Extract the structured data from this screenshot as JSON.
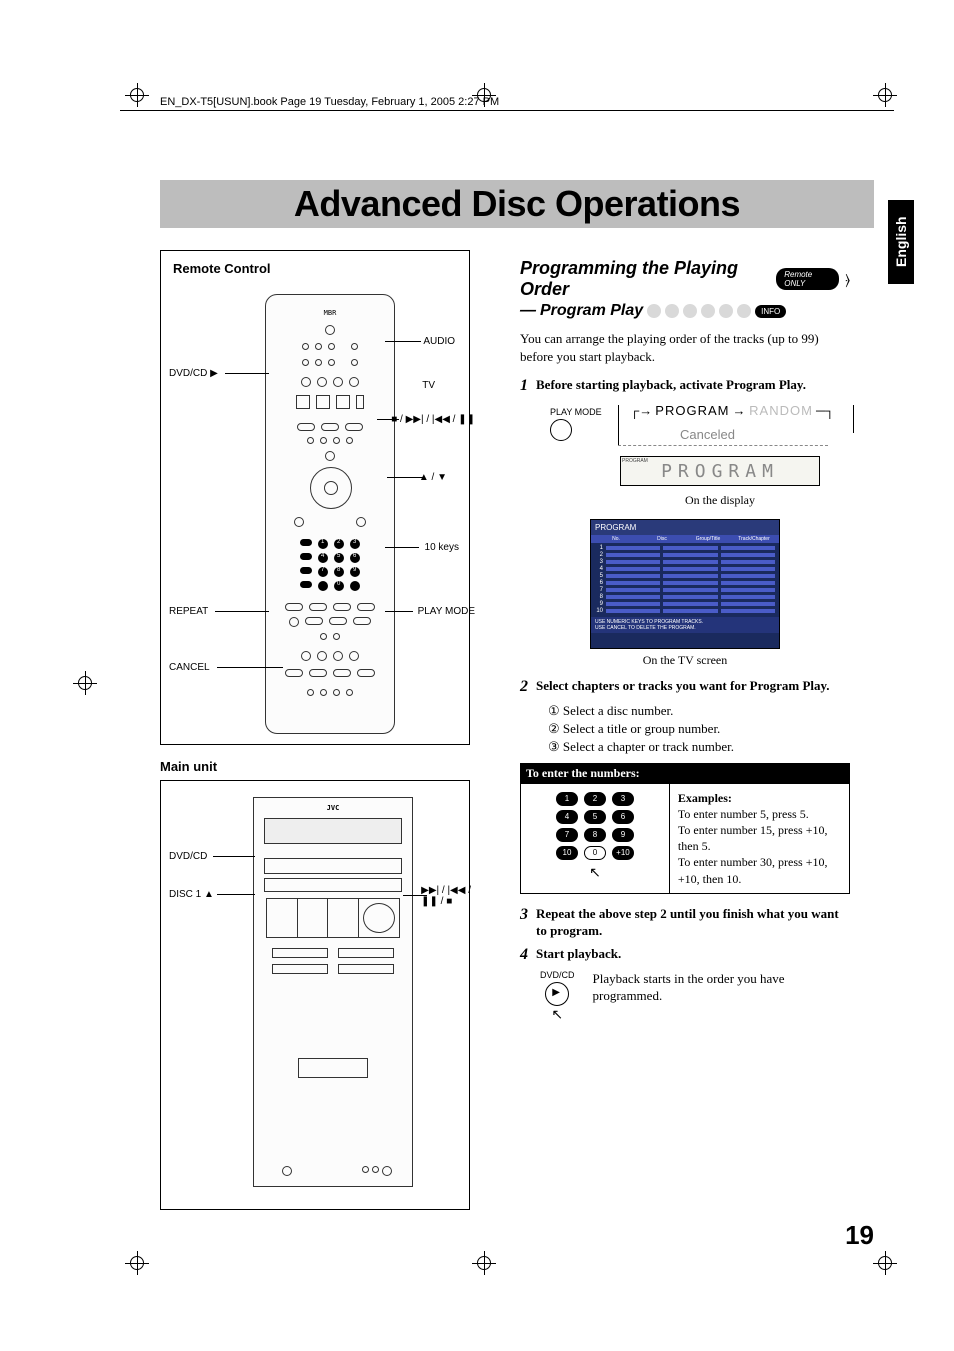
{
  "header": {
    "meta_line": "EN_DX-T5[USUN].book  Page 19  Tuesday, February 1, 2005  2:27 PM"
  },
  "lang_tab": "English",
  "title": "Advanced Disc Operations",
  "left": {
    "remote_title": "Remote Control",
    "main_unit_title": "Main unit",
    "labels": {
      "dvdcd_play": "DVD/CD ▶",
      "repeat": "REPEAT",
      "cancel": "CANCEL",
      "audio": "AUDIO",
      "tv": "TV",
      "ten_keys": "10 keys",
      "play_mode": "PLAY MODE",
      "stop_next": "■ / ▶▶| / |◀◀ / ❚❚",
      "up_down": "▲ / ▼",
      "dvdcd": "DVD/CD",
      "disc1": "DISC 1 ▲",
      "main_right": "▶▶| / |◀◀ /\n❚❚ / ■",
      "mbr": "MBR",
      "jvc": "JVC"
    }
  },
  "right": {
    "section_title": "Programming the Playing Order",
    "remote_only": "Remote ONLY",
    "subtitle_prefix": "—",
    "subtitle": "Program Play",
    "info": "INFO",
    "intro": "You can arrange the playing order of the tracks (up to 99) before you start playback.",
    "steps": {
      "s1": {
        "num": "1",
        "text": "Before starting playback, activate Program Play."
      },
      "s2": {
        "num": "2",
        "text": "Select chapters or tracks you want for Program Play."
      },
      "s3": {
        "num": "3",
        "text": "Repeat the above step 2 until you finish what you want to program."
      },
      "s4": {
        "num": "4",
        "text": "Start playback."
      }
    },
    "sub_items": {
      "a": "① Select a disc number.",
      "b": "② Select a title or group number.",
      "c": "③ Select a chapter or track number."
    },
    "diagram": {
      "play_mode": "PLAY MODE",
      "program": "PROGRAM",
      "random": "RANDOM",
      "canceled": "Canceled",
      "lcd": "PROGRAM",
      "caption1": "On the display",
      "caption2": "On the TV screen"
    },
    "tv": {
      "title": "PROGRAM",
      "hdr": {
        "no": "No.",
        "disc": "Disc",
        "group": "Group/Title",
        "track": "Track/Chapter"
      },
      "footer1": "USE NUMERIC KEYS TO PROGRAM TRACKS.",
      "footer2": "USE CANCEL TO DELETE THE PROGRAM."
    },
    "numbers": {
      "header": "To enter the numbers:",
      "keys": [
        "1",
        "2",
        "3",
        "4",
        "5",
        "6",
        "7",
        "8",
        "9",
        "10",
        "0",
        "+10"
      ],
      "examples_hdr": "Examples:",
      "ex1": "To enter number 5, press 5.",
      "ex2": "To enter number 15, press +10, then 5.",
      "ex3": "To enter number 30, press +10, +10, then 10."
    },
    "play": {
      "label": "DVD/CD",
      "desc": "Playback starts in the order you have programmed."
    }
  },
  "page_number": "19"
}
